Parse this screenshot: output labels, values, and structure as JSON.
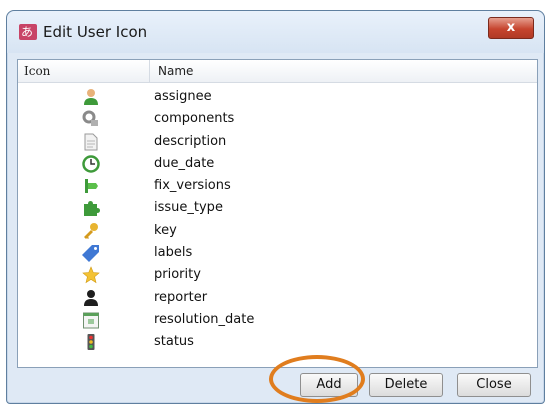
{
  "window": {
    "title": "Edit User Icon",
    "close_label": "x"
  },
  "list": {
    "columns": {
      "icon": "Icon",
      "name": "Name"
    },
    "rows": [
      {
        "icon": "assignee-person-icon",
        "name": "assignee"
      },
      {
        "icon": "components-icon",
        "name": "components"
      },
      {
        "icon": "description-document-icon",
        "name": "description"
      },
      {
        "icon": "clock-icon",
        "name": "due_date"
      },
      {
        "icon": "fix-versions-icon",
        "name": "fix_versions"
      },
      {
        "icon": "puzzle-icon",
        "name": "issue_type"
      },
      {
        "icon": "key-icon",
        "name": "key"
      },
      {
        "icon": "tag-icon",
        "name": "labels"
      },
      {
        "icon": "star-icon",
        "name": "priority"
      },
      {
        "icon": "reporter-person-icon",
        "name": "reporter"
      },
      {
        "icon": "calendar-icon",
        "name": "resolution_date"
      },
      {
        "icon": "traffic-light-icon",
        "name": "status"
      }
    ]
  },
  "buttons": {
    "add": "Add",
    "delete": "Delete",
    "close": "Close"
  },
  "colors": {
    "highlight": "#e07d1e",
    "close_button": "#c6452f"
  }
}
